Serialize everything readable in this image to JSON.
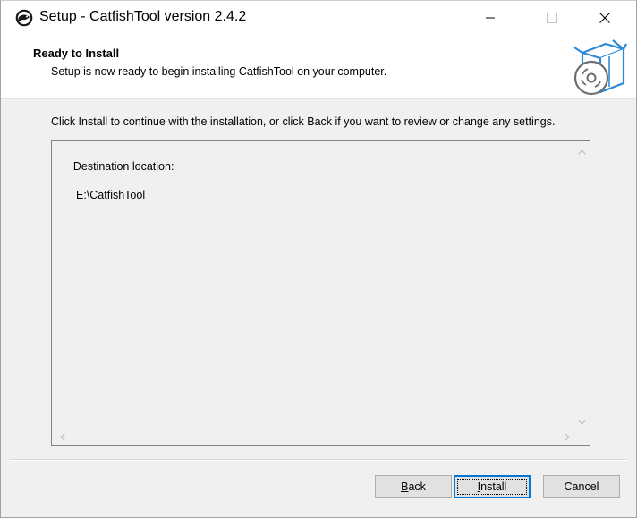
{
  "window": {
    "title": "Setup - CatfishTool version 2.4.2",
    "app_icon": "catfish-logo-icon",
    "controls": {
      "minimize": "minimize-icon",
      "maximize": "maximize-icon",
      "close": "close-icon"
    }
  },
  "header": {
    "title": "Ready to Install",
    "subtitle": "Setup is now ready to begin installing CatfishTool on your computer.",
    "graphic": "install-box-disc-icon"
  },
  "body": {
    "instruction": "Click Install to continue with the installation, or click Back if you want to review or change any settings.",
    "memo": {
      "label": "Destination location:",
      "value": "E:\\CatfishTool"
    }
  },
  "buttons": {
    "back": {
      "accel": "B",
      "rest": "ack"
    },
    "install": {
      "accel": "I",
      "rest": "nstall"
    },
    "cancel": "Cancel"
  },
  "colors": {
    "accent": "#0078d7",
    "icon_blue": "#2b8ad8",
    "icon_gray": "#6e6e6e"
  }
}
